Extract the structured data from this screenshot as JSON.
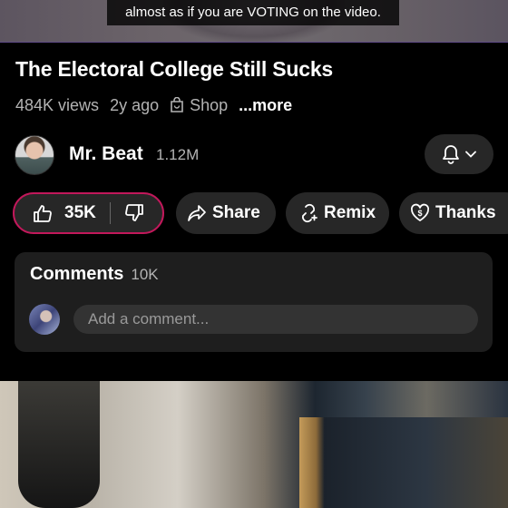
{
  "video": {
    "caption": "almost as if you are VOTING on the video.",
    "title": "The Electoral College Still Sucks",
    "views": "484K views",
    "age": "2y ago",
    "shop_label": "Shop",
    "more_label": "...more"
  },
  "channel": {
    "name": "Mr. Beat",
    "subscribers": "1.12M"
  },
  "actions": {
    "like_count": "35K",
    "share_label": "Share",
    "remix_label": "Remix",
    "thanks_label": "Thanks"
  },
  "comments": {
    "title": "Comments",
    "count": "10K",
    "placeholder": "Add a comment..."
  },
  "colors": {
    "accent": "#c2185b",
    "pill_bg": "#272727",
    "card_bg": "#1e1e1e"
  }
}
